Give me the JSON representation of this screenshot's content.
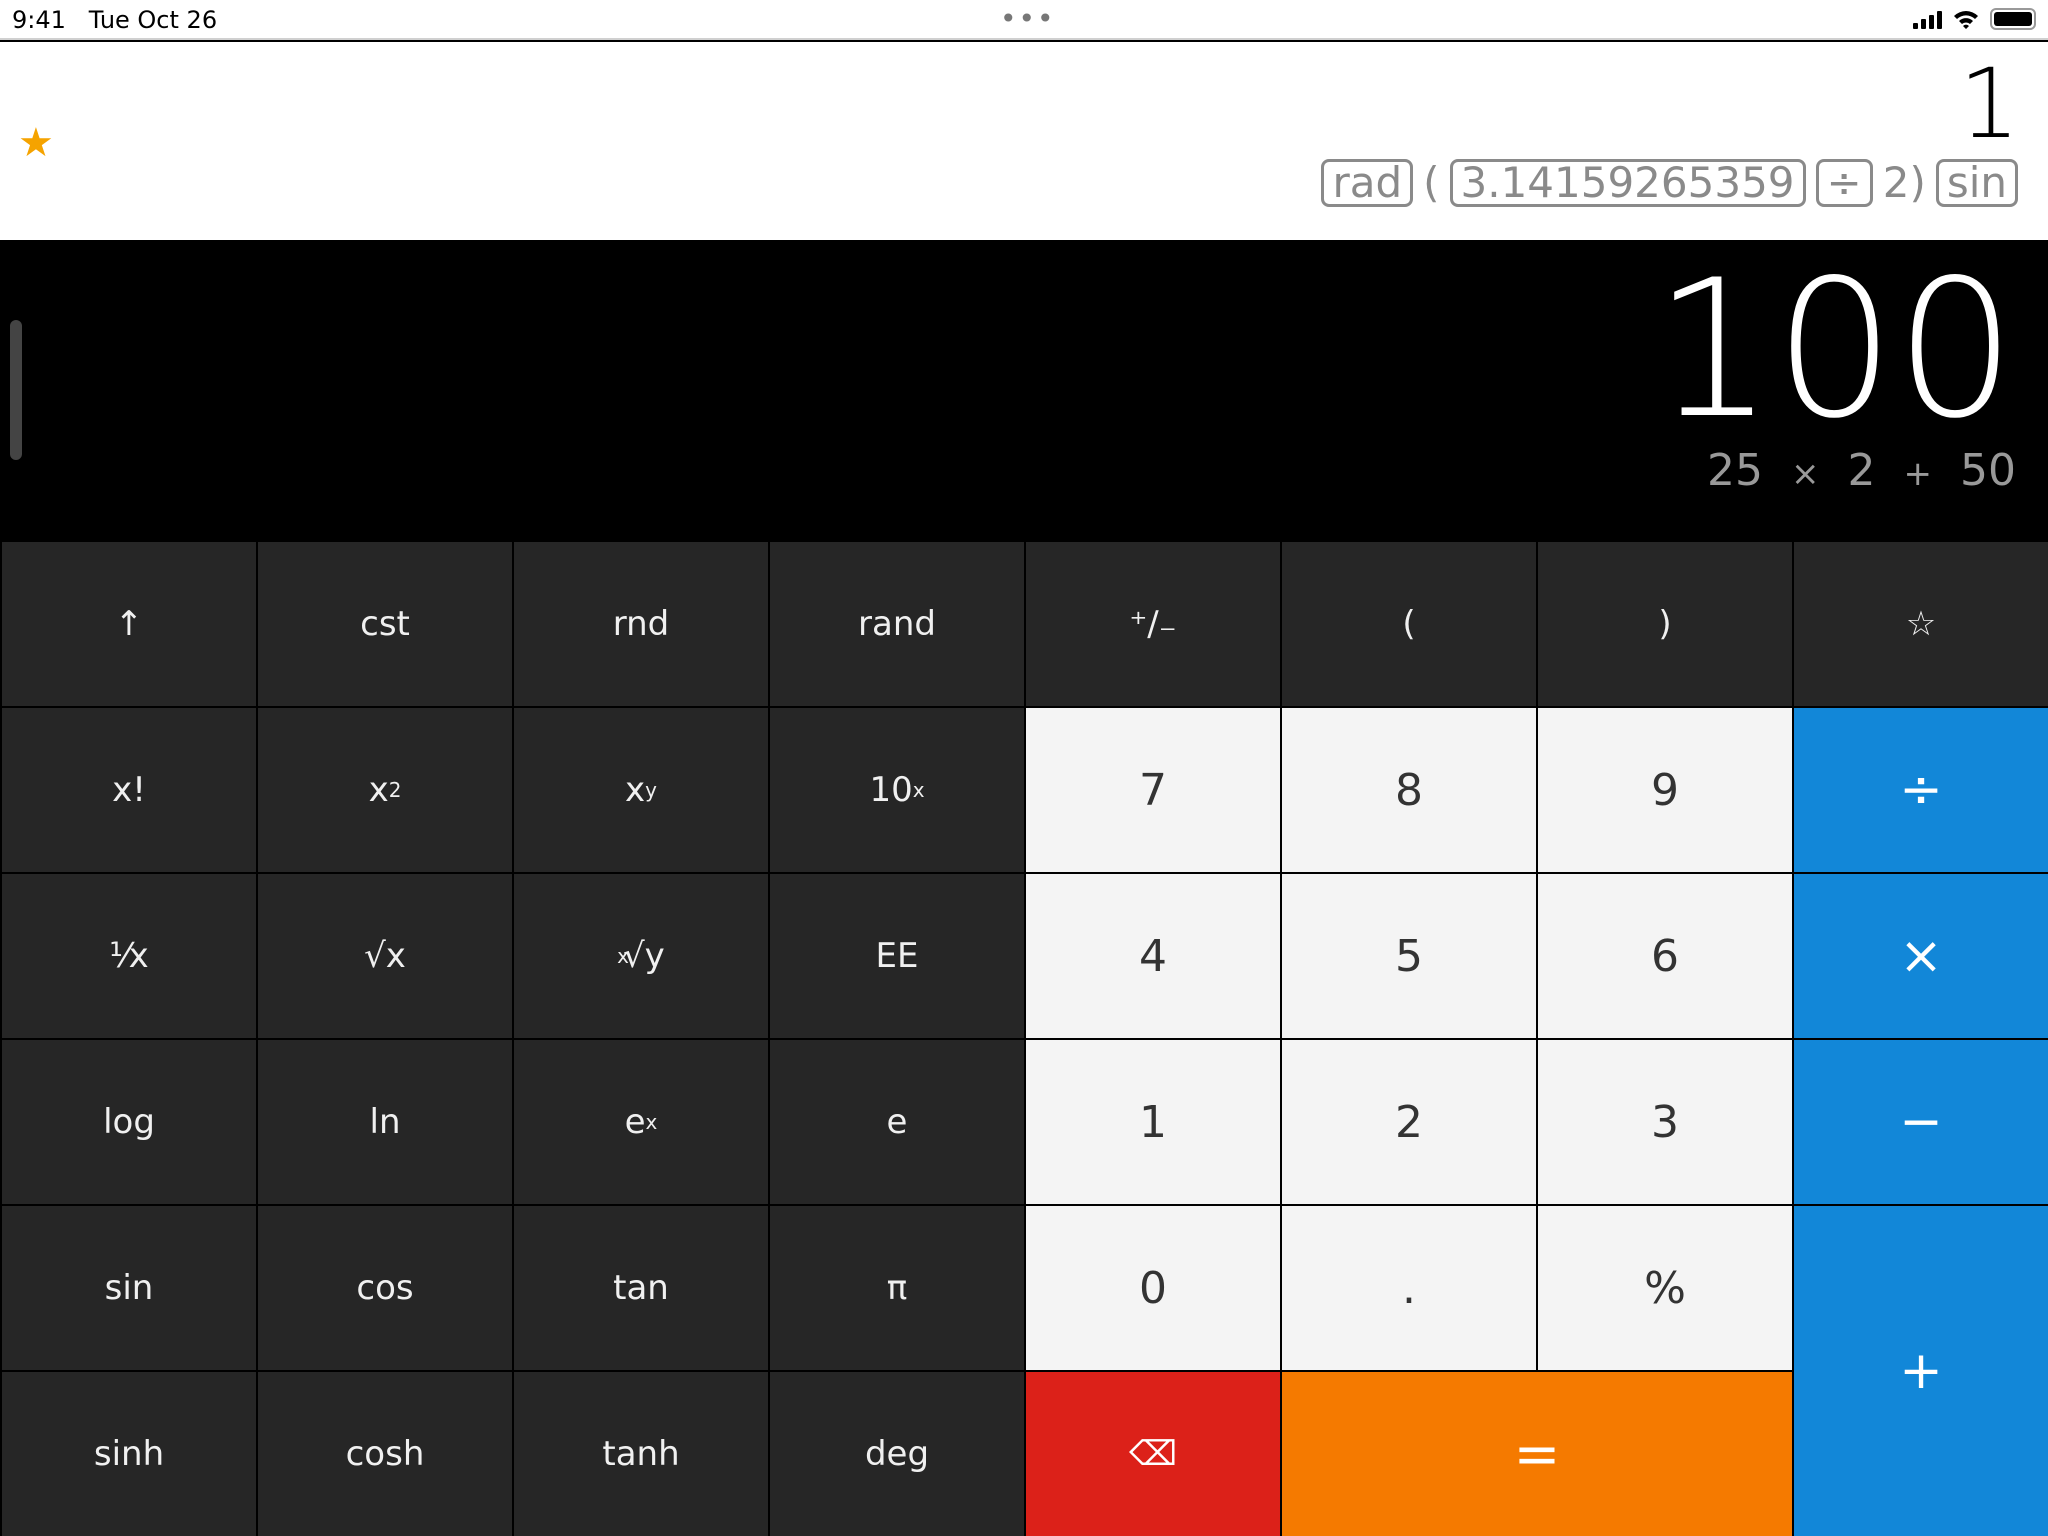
{
  "status": {
    "time": "9:41",
    "date": "Tue Oct 26",
    "more": "•••",
    "icons": [
      "cellular-signal-icon",
      "wifi-icon",
      "battery-icon"
    ]
  },
  "header": {
    "favorite_icon": "star-filled",
    "result": "1",
    "expression": [
      {
        "t": "rad",
        "boxed": true
      },
      {
        "t": "(",
        "boxed": false
      },
      {
        "t": "3.14159265359",
        "boxed": true
      },
      {
        "t": "÷",
        "boxed": true
      },
      {
        "t": "2)",
        "boxed": false
      },
      {
        "t": "sin",
        "boxed": true
      }
    ]
  },
  "display": {
    "value": "100",
    "expression": [
      "25",
      "×",
      "2",
      "+",
      "50"
    ]
  },
  "colors": {
    "dark_key": "#262626",
    "digit_key": "#f4f4f4",
    "operator_key": "#1287d8",
    "delete_key": "#dc2119",
    "equals_key": "#f57a00",
    "favorite": "#f5a300"
  },
  "keys": [
    {
      "id": "shift",
      "label": "↑",
      "type": "dark",
      "icon": "arrow-up-icon"
    },
    {
      "id": "cst",
      "label": "cst",
      "type": "dark"
    },
    {
      "id": "rnd",
      "label": "rnd",
      "type": "dark"
    },
    {
      "id": "rand",
      "label": "rand",
      "type": "dark"
    },
    {
      "id": "negate",
      "label": "⁺∕₋",
      "type": "dark",
      "icon": "plus-minus-icon"
    },
    {
      "id": "lparen",
      "label": "(",
      "type": "dark"
    },
    {
      "id": "rparen",
      "label": ")",
      "type": "dark"
    },
    {
      "id": "favorite",
      "label": "☆",
      "type": "dark",
      "icon": "star-outline-icon"
    },
    {
      "id": "factorial",
      "label": "x!",
      "type": "dark"
    },
    {
      "id": "square",
      "label": "x",
      "sup": "2",
      "type": "dark"
    },
    {
      "id": "power",
      "label": "x",
      "sup": "y",
      "type": "dark"
    },
    {
      "id": "ten-power",
      "label": "10",
      "sup": "x",
      "type": "dark"
    },
    {
      "id": "7",
      "label": "7",
      "type": "light"
    },
    {
      "id": "8",
      "label": "8",
      "type": "light"
    },
    {
      "id": "9",
      "label": "9",
      "type": "light"
    },
    {
      "id": "divide",
      "label": "÷",
      "type": "opk"
    },
    {
      "id": "reciprocal",
      "label": "¹⁄x",
      "type": "dark"
    },
    {
      "id": "sqrt",
      "label": "√x",
      "type": "dark"
    },
    {
      "id": "root",
      "label": "√y",
      "pre": "x",
      "type": "dark"
    },
    {
      "id": "ee",
      "label": "EE",
      "type": "dark"
    },
    {
      "id": "4",
      "label": "4",
      "type": "light"
    },
    {
      "id": "5",
      "label": "5",
      "type": "light"
    },
    {
      "id": "6",
      "label": "6",
      "type": "light"
    },
    {
      "id": "multiply",
      "label": "×",
      "type": "opk"
    },
    {
      "id": "log",
      "label": "log",
      "type": "dark"
    },
    {
      "id": "ln",
      "label": "ln",
      "type": "dark"
    },
    {
      "id": "exp",
      "label": "e",
      "sup": "x",
      "type": "dark"
    },
    {
      "id": "e",
      "label": "e",
      "type": "dark"
    },
    {
      "id": "1",
      "label": "1",
      "type": "light"
    },
    {
      "id": "2",
      "label": "2",
      "type": "light"
    },
    {
      "id": "3",
      "label": "3",
      "type": "light"
    },
    {
      "id": "subtract",
      "label": "−",
      "type": "opk"
    },
    {
      "id": "sin",
      "label": "sin",
      "type": "dark"
    },
    {
      "id": "cos",
      "label": "cos",
      "type": "dark"
    },
    {
      "id": "tan",
      "label": "tan",
      "type": "dark"
    },
    {
      "id": "pi",
      "label": "π",
      "type": "dark"
    },
    {
      "id": "0",
      "label": "0",
      "type": "light"
    },
    {
      "id": "decimal",
      "label": ".",
      "type": "light"
    },
    {
      "id": "percent",
      "label": "%",
      "type": "light"
    },
    {
      "id": "add",
      "label": "+",
      "type": "opk"
    },
    {
      "id": "sinh",
      "label": "sinh",
      "type": "dark"
    },
    {
      "id": "cosh",
      "label": "cosh",
      "type": "dark"
    },
    {
      "id": "tanh",
      "label": "tanh",
      "type": "dark"
    },
    {
      "id": "deg",
      "label": "deg",
      "type": "dark"
    },
    {
      "id": "backspace",
      "label": "⌫",
      "type": "del",
      "icon": "backspace-icon"
    },
    {
      "id": "equals",
      "label": "=",
      "type": "eq"
    }
  ]
}
